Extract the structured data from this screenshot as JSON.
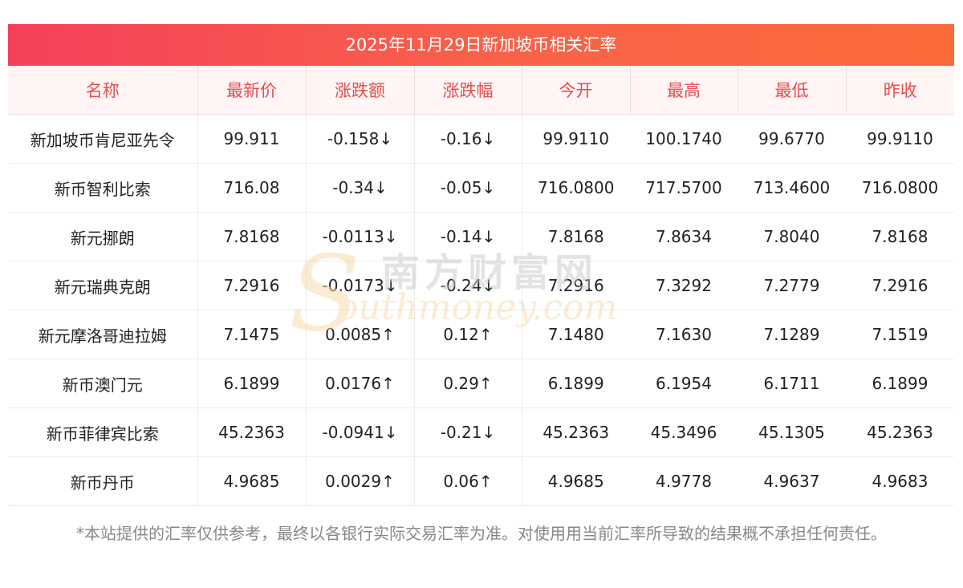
{
  "title": "2025年11月29日新加坡币相关汇率",
  "headers": [
    "名称",
    "最新价",
    "涨跌额",
    "涨跌幅",
    "今开",
    "最高",
    "最低",
    "昨收"
  ],
  "rows": [
    {
      "name": "新加坡币肯尼亚先令",
      "latest": "99.911",
      "change": "-0.158↓",
      "pct": "-0.16↓",
      "open": "99.9110",
      "high": "100.1740",
      "low": "99.6770",
      "prev": "99.9110",
      "dir": "down"
    },
    {
      "name": "新币智利比索",
      "latest": "716.08",
      "change": "-0.34↓",
      "pct": "-0.05↓",
      "open": "716.0800",
      "high": "717.5700",
      "low": "713.4600",
      "prev": "716.0800",
      "dir": "down"
    },
    {
      "name": "新元挪朗",
      "latest": "7.8168",
      "change": "-0.0113↓",
      "pct": "-0.14↓",
      "open": "7.8168",
      "high": "7.8634",
      "low": "7.8040",
      "prev": "7.8168",
      "dir": "down"
    },
    {
      "name": "新元瑞典克朗",
      "latest": "7.2916",
      "change": "-0.0173↓",
      "pct": "-0.24↓",
      "open": "7.2916",
      "high": "7.3292",
      "low": "7.2779",
      "prev": "7.2916",
      "dir": "down"
    },
    {
      "name": "新元摩洛哥迪拉姆",
      "latest": "7.1475",
      "change": "0.0085↑",
      "pct": "0.12↑",
      "open": "7.1480",
      "high": "7.1630",
      "low": "7.1289",
      "prev": "7.1519",
      "dir": "up"
    },
    {
      "name": "新币澳门元",
      "latest": "6.1899",
      "change": "0.0176↑",
      "pct": "0.29↑",
      "open": "6.1899",
      "high": "6.1954",
      "low": "6.1711",
      "prev": "6.1899",
      "dir": "up"
    },
    {
      "name": "新币菲律宾比索",
      "latest": "45.2363",
      "change": "-0.0941↓",
      "pct": "-0.21↓",
      "open": "45.2363",
      "high": "45.3496",
      "low": "45.1305",
      "prev": "45.2363",
      "dir": "down"
    },
    {
      "name": "新币丹币",
      "latest": "4.9685",
      "change": "0.0029↑",
      "pct": "0.06↑",
      "open": "4.9685",
      "high": "4.9778",
      "low": "4.9637",
      "prev": "4.9683",
      "dir": "up"
    }
  ],
  "watermark": {
    "cn": "南方财富网",
    "en": "outhmoney.com",
    "s": "S"
  },
  "footnote": "*本站提供的汇率仅供参考，最终以各银行实际交易汇率为准。对使用用当前汇率所导致的结果概不承担任何责任。",
  "colors": {
    "up": "#ee1111",
    "down": "#1a8a1a",
    "header_text": "#e84c4c",
    "title_bg_start": "#f5405a",
    "title_bg_end": "#fb6b3a"
  }
}
